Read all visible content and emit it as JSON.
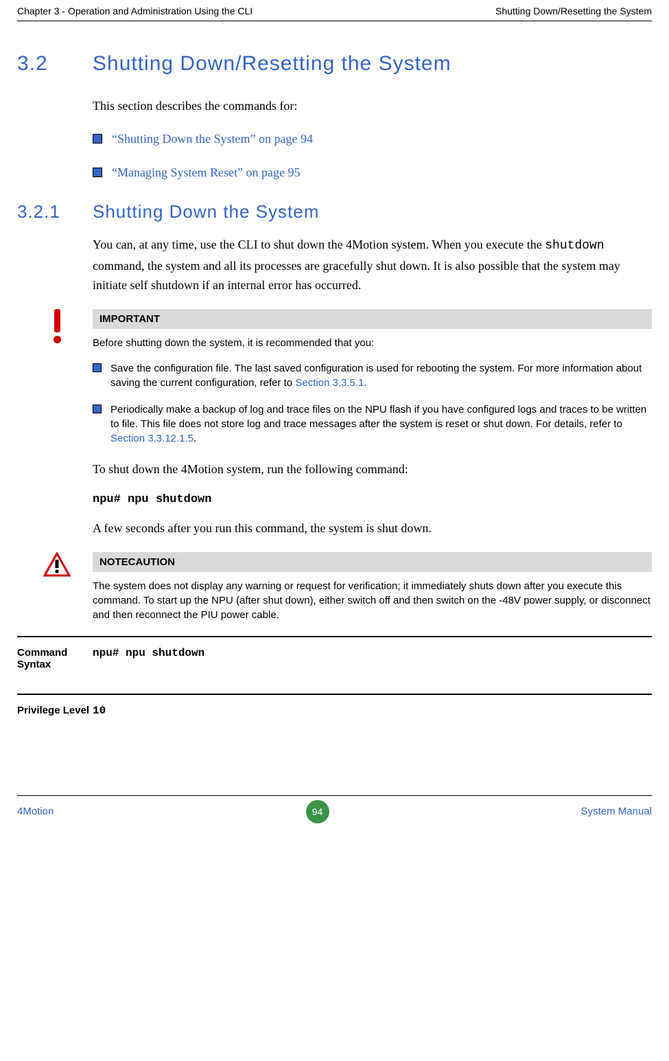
{
  "header": {
    "left": "Chapter 3 - Operation and Administration Using the CLI",
    "right": "Shutting Down/Resetting the System"
  },
  "section": {
    "num": "3.2",
    "title": "Shutting Down/Resetting the System",
    "intro": "This section describes the commands for:",
    "bullets": [
      "“Shutting Down the System” on page 94",
      "“Managing System Reset” on page 95"
    ]
  },
  "subsection": {
    "num": "3.2.1",
    "title": "Shutting Down the System",
    "para1_a": "You can, at any time, use the CLI to shut down the 4Motion system. When you execute the ",
    "para1_cmd": "shutdown",
    "para1_b": " command, the system and all its processes are gracefully shut down. It is also possible that the system may initiate self shutdown if an internal error has occurred."
  },
  "important": {
    "label": "IMPORTANT",
    "lead": "Before shutting down the system, it is recommended that you:",
    "items": [
      {
        "text_a": "Save the configuration file. The last saved configuration is used for rebooting the system. For more information about saving the current configuration, refer to ",
        "link": "Section 3.3.5.1",
        "text_b": "."
      },
      {
        "text_a": "Periodically make a backup of log and trace files on the NPU flash if you have configured logs and traces to be written to file. This file does not store log and trace messages after the system is reset or shut down. For details, refer to ",
        "link": "Section 3.3.12.1.5",
        "text_b": "."
      }
    ]
  },
  "run_cmd": {
    "lead": "To shut down the 4Motion system, run the following command:",
    "cmd": "npu# npu shutdown",
    "after": "A few seconds after you run this command, the system is shut down."
  },
  "caution": {
    "label": "NOTECAUTION",
    "text": "The system does not display any warning or request for verification; it immediately shuts down after you execute this command. To start up the NPU (after shut down), either switch off and then switch on the -48V power supply, or disconnect and then reconnect the PIU power cable."
  },
  "table": {
    "row1_label": "Command Syntax",
    "row1_value": "npu# npu shutdown",
    "row2_label": "Privilege Level",
    "row2_value": "10"
  },
  "footer": {
    "left": "4Motion",
    "page": "94",
    "right": "System Manual"
  }
}
